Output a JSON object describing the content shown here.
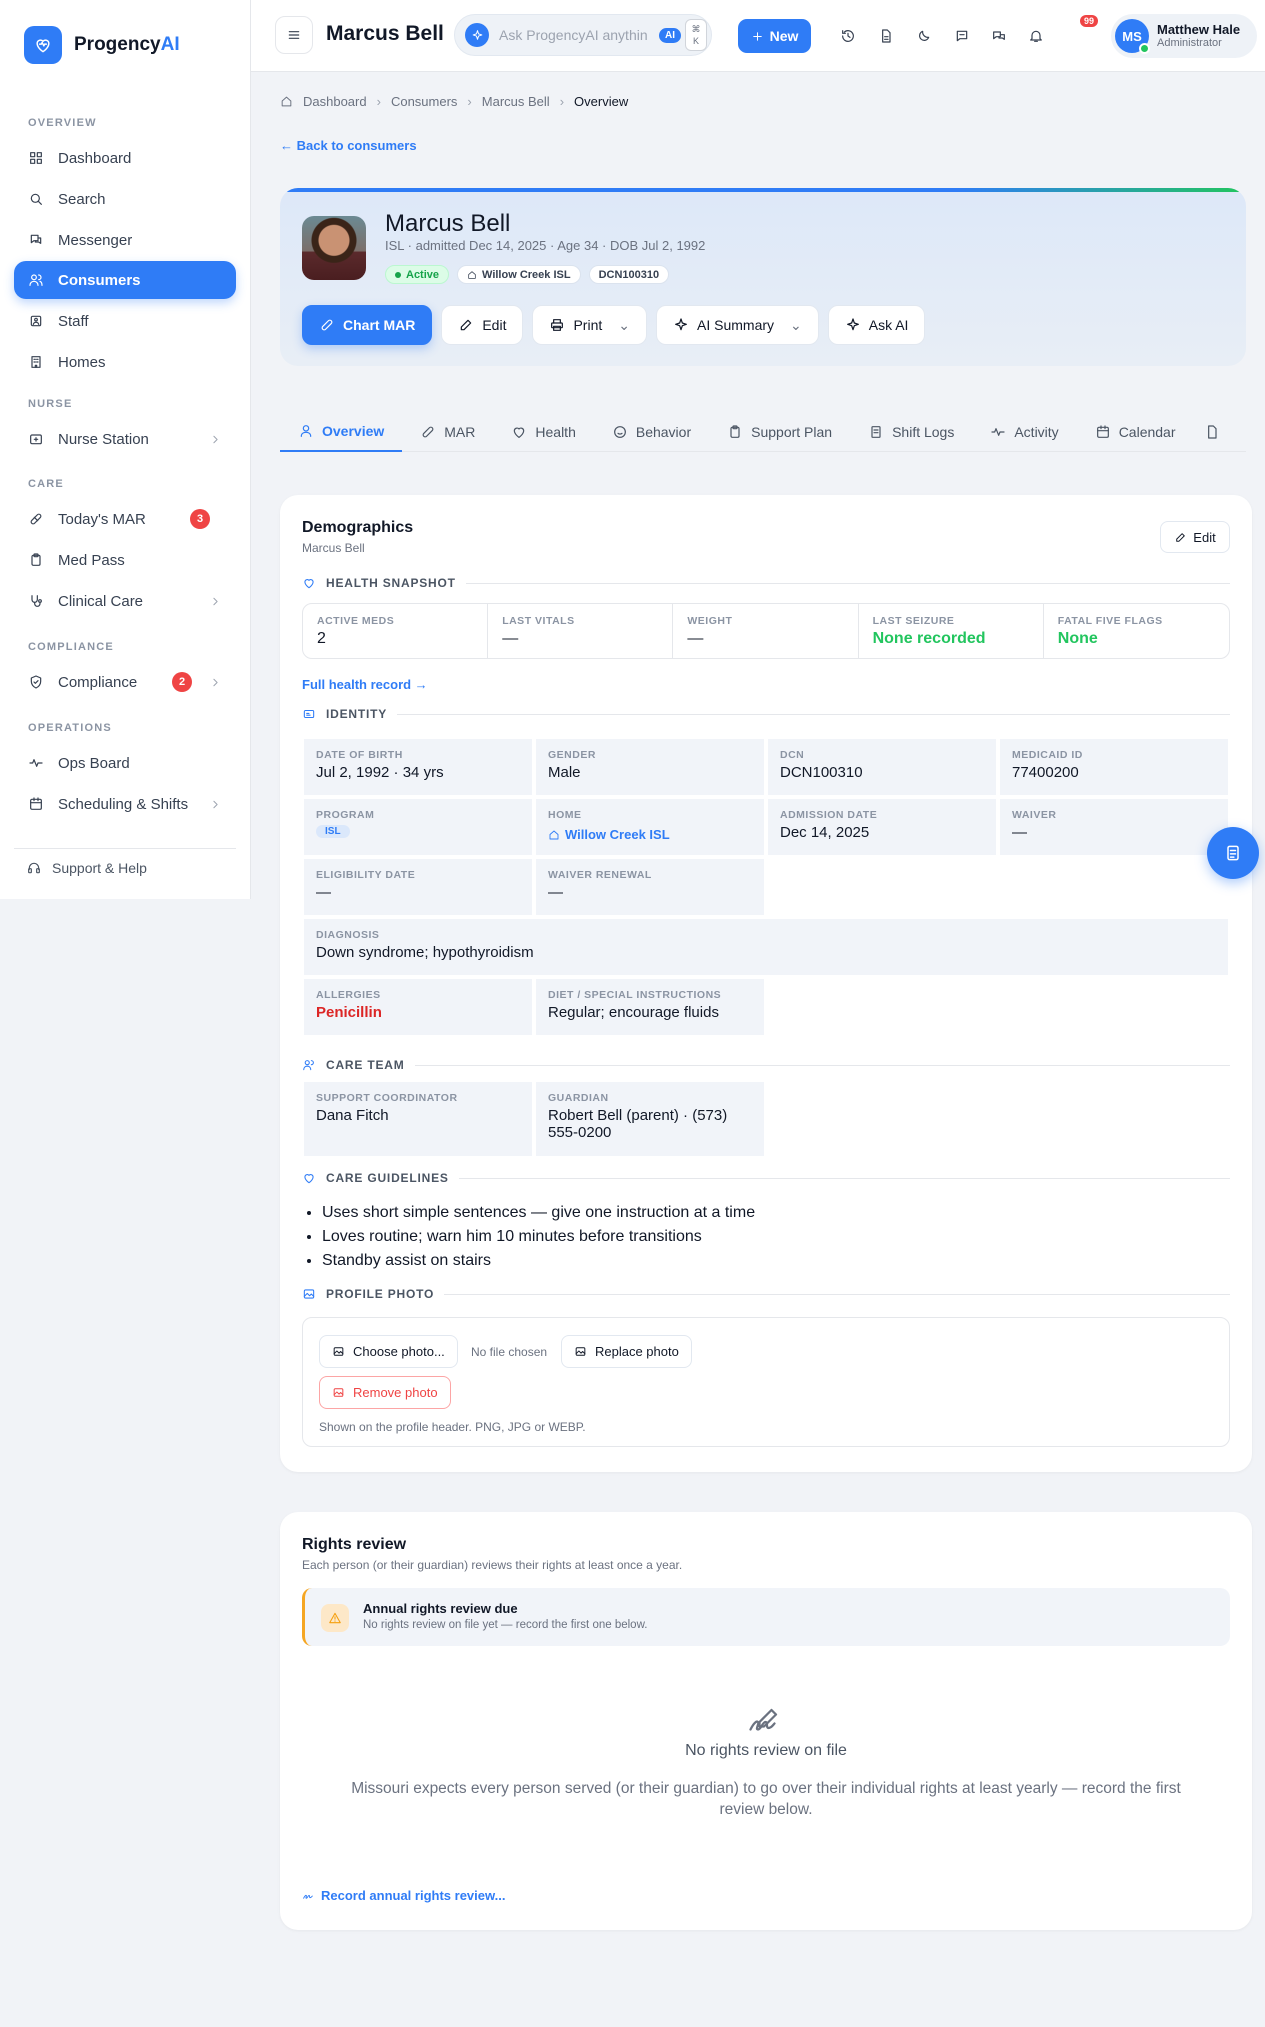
{
  "app": {
    "name_prefix": "Progency",
    "name_suffix": "AI"
  },
  "sidebar": {
    "sections": [
      "OVERVIEW",
      "NURSE",
      "CARE",
      "COMPLIANCE",
      "OPERATIONS"
    ],
    "items": [
      {
        "label": "Dashboard",
        "icon": "grid-icon"
      },
      {
        "label": "Search",
        "icon": "search-icon"
      },
      {
        "label": "Messenger",
        "icon": "chat-icon"
      },
      {
        "label": "Consumers",
        "icon": "users-icon",
        "active": true
      },
      {
        "label": "Staff",
        "icon": "staff-icon"
      },
      {
        "label": "Homes",
        "icon": "building-icon"
      },
      {
        "label": "Nurse Station",
        "icon": "nurse-icon"
      },
      {
        "label": "Today's MAR",
        "icon": "pill-icon",
        "badge": "3"
      },
      {
        "label": "Med Pass",
        "icon": "clipboard-icon"
      },
      {
        "label": "Clinical Care",
        "icon": "stethoscope-icon"
      },
      {
        "label": "Compliance",
        "icon": "compliance-icon",
        "badge": "2"
      },
      {
        "label": "Ops Board",
        "icon": "pulse-icon"
      },
      {
        "label": "Scheduling & Shifts",
        "icon": "calendar-icon"
      }
    ],
    "support": "Support & Help"
  },
  "topbar": {
    "title": "Marcus Bell",
    "ask_placeholder": "Ask ProgencyAI anythin",
    "ask_badge": "AI",
    "kbd_1": "⌘",
    "kbd_2": "K",
    "new_label": "New",
    "notif_count": "99",
    "user_initials": "MS",
    "user_name": "Matthew Hale",
    "user_role": "Administrator"
  },
  "breadcrumb": [
    "Dashboard",
    "Consumers",
    "Marcus Bell",
    "Overview"
  ],
  "back_link": "Back to consumers",
  "profile": {
    "name": "Marcus Bell",
    "meta": "ISL · admitted Dec 14, 2025 · Age 34 · DOB Jul 2, 1992",
    "status": "Active",
    "home": "Willow Creek ISL",
    "dcn": "DCN100310",
    "actions": {
      "chart_mar": "Chart MAR",
      "edit": "Edit",
      "print": "Print",
      "ai_summary": "AI Summary",
      "ask_ai": "Ask AI"
    }
  },
  "tabs": [
    "Overview",
    "MAR",
    "Health",
    "Behavior",
    "Support Plan",
    "Shift Logs",
    "Activity",
    "Calendar"
  ],
  "demographics": {
    "title": "Demographics",
    "subtitle": "Marcus Bell",
    "edit": "Edit",
    "health_snapshot_label": "HEALTH SNAPSHOT",
    "snapshot": [
      {
        "label": "ACTIVE MEDS",
        "value": "2"
      },
      {
        "label": "LAST VITALS",
        "value": "—"
      },
      {
        "label": "WEIGHT",
        "value": "—"
      },
      {
        "label": "LAST SEIZURE",
        "value": "None recorded"
      },
      {
        "label": "FATAL FIVE FLAGS",
        "value": "None"
      }
    ],
    "full_health_link": "Full health record →",
    "identity_label": "IDENTITY",
    "identity": {
      "dob": {
        "label": "DATE OF BIRTH",
        "value": "Jul 2, 1992 · 34 yrs"
      },
      "gender": {
        "label": "GENDER",
        "value": "Male"
      },
      "dcn": {
        "label": "DCN",
        "value": "DCN100310"
      },
      "medicaid": {
        "label": "MEDICAID ID",
        "value": "77400200"
      },
      "program": {
        "label": "PROGRAM",
        "value": "ISL"
      },
      "home": {
        "label": "HOME",
        "value": "Willow Creek ISL"
      },
      "admission": {
        "label": "ADMISSION DATE",
        "value": "Dec 14, 2025"
      },
      "waiver": {
        "label": "WAIVER",
        "value": "—"
      },
      "eligibility": {
        "label": "ELIGIBILITY DATE",
        "value": "—"
      },
      "waiver_renewal": {
        "label": "WAIVER RENEWAL",
        "value": "—"
      },
      "diagnosis": {
        "label": "DIAGNOSIS",
        "value": "Down syndrome; hypothyroidism"
      },
      "allergies": {
        "label": "ALLERGIES",
        "value": "Penicillin"
      },
      "diet": {
        "label": "DIET / SPECIAL INSTRUCTIONS",
        "value": "Regular; encourage fluids"
      }
    },
    "care_team_label": "CARE TEAM",
    "care_team": {
      "coordinator": {
        "label": "SUPPORT COORDINATOR",
        "value": "Dana Fitch"
      },
      "guardian": {
        "label": "GUARDIAN",
        "value": "Robert Bell (parent) · (573) 555-0200"
      }
    },
    "guidelines_label": "CARE GUIDELINES",
    "guidelines": [
      "Uses short simple sentences — give one instruction at a time",
      "Loves routine; warn him 10 minutes before transitions",
      "Standby assist on stairs"
    ],
    "photo_label": "PROFILE PHOTO",
    "photo": {
      "choose": "Choose photo...",
      "no_file": "No file chosen",
      "replace": "Replace photo",
      "remove": "Remove photo",
      "hint": "Shown on the profile header. PNG, JPG or WEBP."
    }
  },
  "rights": {
    "title": "Rights review",
    "subtitle": "Each person (or their guardian) reviews their rights at least once a year.",
    "alert_title": "Annual rights review due",
    "alert_sub": "No rights review on file yet — record the first one below.",
    "empty_title": "No rights review on file",
    "empty_sub": "Missouri expects every person served (or their guardian) to go over their individual rights at least yearly — record the first review below.",
    "record_link": "Record annual rights review..."
  },
  "colors": {
    "primary": "#2f7cf6",
    "danger": "#ef4444",
    "success": "#22c55e",
    "warning": "#f5a623"
  }
}
